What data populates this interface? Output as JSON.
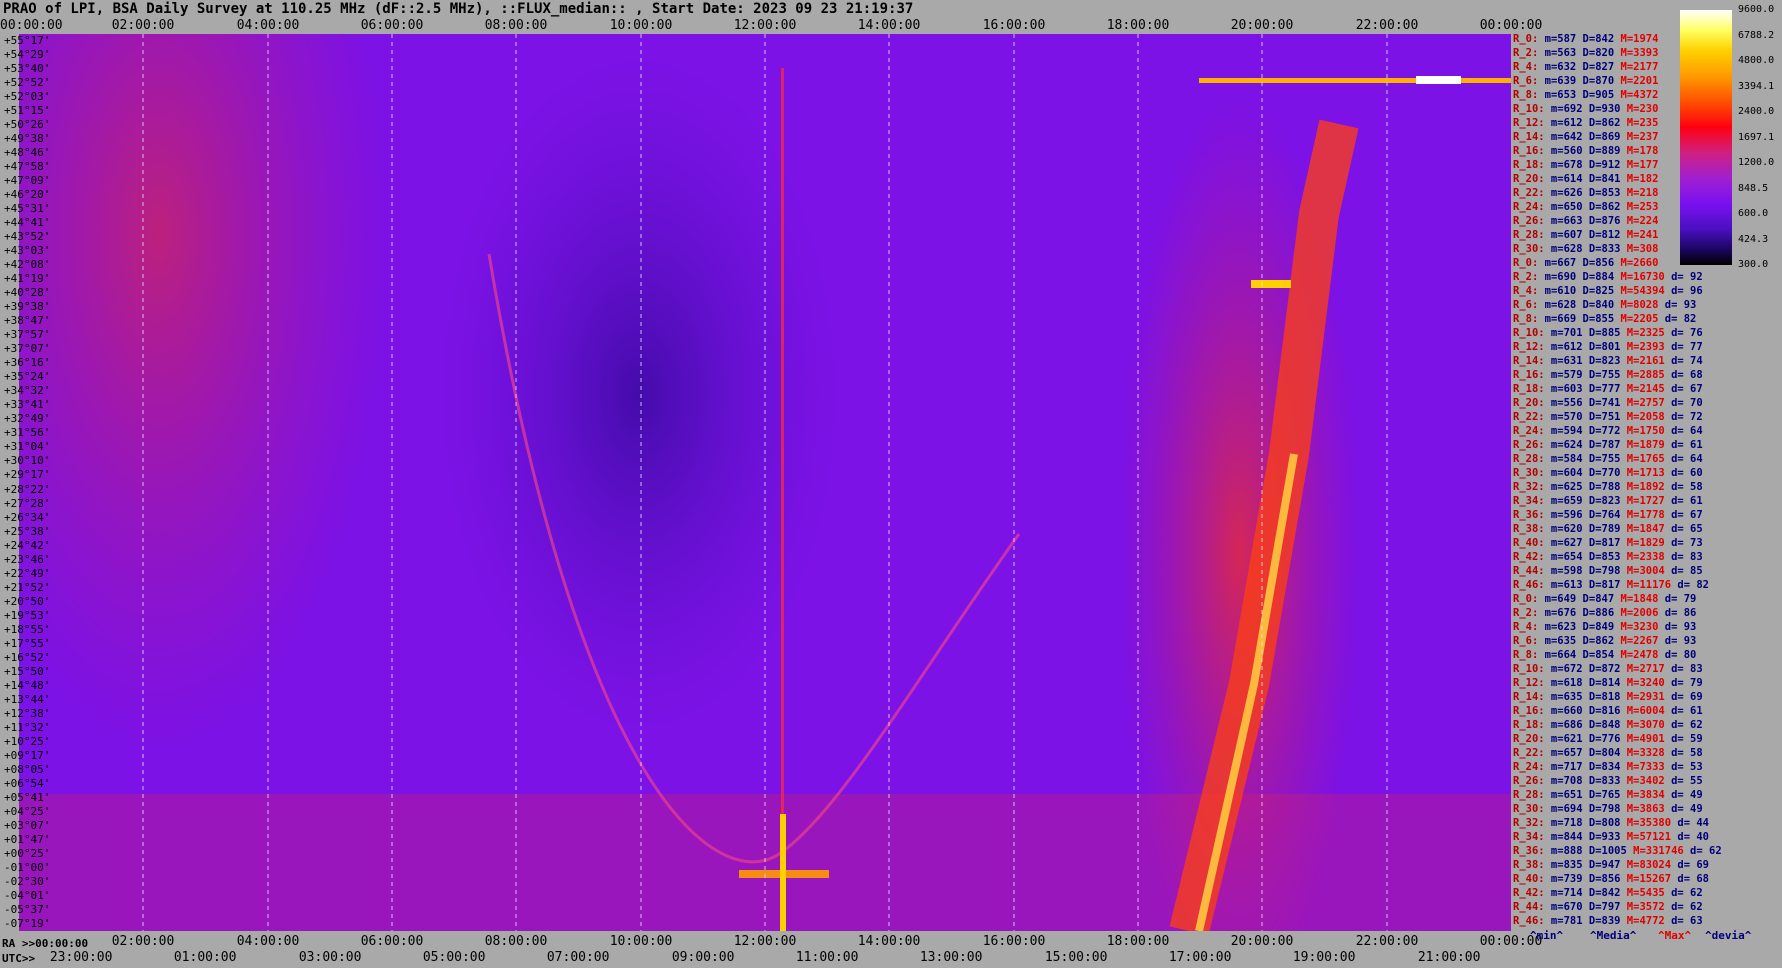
{
  "title": "PRAO of LPI, BSA Daily Survey at 110.25 MHz (dF::2.5 MHz), ::FLUX_median:: , Start Date: 2023 09 23 21:19:37",
  "chart_data": {
    "type": "heatmap",
    "title": "PRAO of LPI, BSA Daily Survey at 110.25 MHz (dF::2.5 MHz), ::FLUX_median:: , Start Date: 2023 09 23 21:19:37",
    "x_top_ticks": [
      "00:00:00",
      "02:00:00",
      "04:00:00",
      "06:00:00",
      "08:00:00",
      "10:00:00",
      "12:00:00",
      "14:00:00",
      "16:00:00",
      "18:00:00",
      "20:00:00",
      "22:00:00",
      "00:00:00"
    ],
    "x_ra_ticks": [
      "00:00:00",
      "02:00:00",
      "04:00:00",
      "06:00:00",
      "08:00:00",
      "10:00:00",
      "12:00:00",
      "14:00:00",
      "16:00:00",
      "18:00:00",
      "20:00:00",
      "22:00:00",
      "00:00:00"
    ],
    "x_utc_ticks": [
      "23:00:00",
      "01:00:00",
      "03:00:00",
      "05:00:00",
      "07:00:00",
      "09:00:00",
      "11:00:00",
      "13:00:00",
      "15:00:00",
      "17:00:00",
      "19:00:00",
      "21:00:00"
    ],
    "ra_label": "RA >>00:00:00",
    "utc_label": "UTC>>",
    "declinations": [
      "+55°17'",
      "+54°29'",
      "+53°40'",
      "+52°52'",
      "+52°03'",
      "+51°15'",
      "+50°26'",
      "+49°38'",
      "+48°46'",
      "+47°58'",
      "+47°09'",
      "+46°20'",
      "+45°31'",
      "+44°41'",
      "+43°52'",
      "+43°03'",
      "+42°08'",
      "+41°19'",
      "+40°28'",
      "+39°38'",
      "+38°47'",
      "+37°57'",
      "+37°07'",
      "+36°16'",
      "+35°24'",
      "+34°32'",
      "+33°41'",
      "+32°49'",
      "+31°56'",
      "+31°04'",
      "+30°10'",
      "+29°17'",
      "+28°22'",
      "+27°28'",
      "+26°34'",
      "+25°38'",
      "+24°42'",
      "+23°46'",
      "+22°49'",
      "+21°52'",
      "+20°50'",
      "+19°53'",
      "+18°55'",
      "+17°55'",
      "+16°52'",
      "+15°50'",
      "+14°48'",
      "+13°44'",
      "+12°38'",
      "+11°32'",
      "+10°25'",
      "+09°17'",
      "+08°05'",
      "+06°54'",
      "+05°41'",
      "+04°25'",
      "+03°07'",
      "+01°47'",
      "+00°25'",
      "-01°00'",
      "-02°30'",
      "-04°01'",
      "-05°37'",
      "-07°19'"
    ],
    "colorbar": {
      "ticks": [
        "9600.0",
        "6788.2",
        "4800.0",
        "3394.1",
        "2400.0",
        "1697.1",
        "1200.0",
        "848.5",
        "600.0",
        "424.3",
        "300.0"
      ],
      "min": 300.0,
      "max": 9600.0,
      "scale": "log"
    },
    "stats_rows": [
      [
        "R_0:",
        "587",
        "842",
        "1974",
        ""
      ],
      [
        "R_2:",
        "563",
        "820",
        "3393",
        ""
      ],
      [
        "R_4:",
        "632",
        "827",
        "2177",
        ""
      ],
      [
        "R_6:",
        "639",
        "870",
        "2201",
        ""
      ],
      [
        "R_8:",
        "653",
        "905",
        "4372",
        ""
      ],
      [
        "R_10:",
        "692",
        "930",
        "230",
        ""
      ],
      [
        "R_12:",
        "612",
        "862",
        "235",
        ""
      ],
      [
        "R_14:",
        "642",
        "869",
        "237",
        ""
      ],
      [
        "R_16:",
        "560",
        "889",
        "178",
        ""
      ],
      [
        "R_18:",
        "678",
        "912",
        "177",
        ""
      ],
      [
        "R_20:",
        "614",
        "841",
        "182",
        ""
      ],
      [
        "R_22:",
        "626",
        "853",
        "218",
        ""
      ],
      [
        "R_24:",
        "650",
        "862",
        "253",
        ""
      ],
      [
        "R_26:",
        "663",
        "876",
        "224",
        ""
      ],
      [
        "R_28:",
        "607",
        "812",
        "241",
        ""
      ],
      [
        "R_30:",
        "628",
        "833",
        "308",
        ""
      ],
      [
        "R_0:",
        "667",
        "856",
        "2660",
        ""
      ],
      [
        "R_2:",
        "690",
        "884",
        "16730",
        "92"
      ],
      [
        "R_4:",
        "610",
        "825",
        "54394",
        "96"
      ],
      [
        "R_6:",
        "628",
        "840",
        "8028",
        "93"
      ],
      [
        "R_8:",
        "669",
        "855",
        "2205",
        "82"
      ],
      [
        "R_10:",
        "701",
        "885",
        "2325",
        "76"
      ],
      [
        "R_12:",
        "612",
        "801",
        "2393",
        "77"
      ],
      [
        "R_14:",
        "631",
        "823",
        "2161",
        "74"
      ],
      [
        "R_16:",
        "579",
        "755",
        "2885",
        "68"
      ],
      [
        "R_18:",
        "603",
        "777",
        "2145",
        "67"
      ],
      [
        "R_20:",
        "556",
        "741",
        "2757",
        "70"
      ],
      [
        "R_22:",
        "570",
        "751",
        "2058",
        "72"
      ],
      [
        "R_24:",
        "594",
        "772",
        "1750",
        "64"
      ],
      [
        "R_26:",
        "624",
        "787",
        "1879",
        "61"
      ],
      [
        "R_28:",
        "584",
        "755",
        "1765",
        "64"
      ],
      [
        "R_30:",
        "604",
        "770",
        "1713",
        "60"
      ],
      [
        "R_32:",
        "625",
        "788",
        "1892",
        "58"
      ],
      [
        "R_34:",
        "659",
        "823",
        "1727",
        "61"
      ],
      [
        "R_36:",
        "596",
        "764",
        "1778",
        "67"
      ],
      [
        "R_38:",
        "620",
        "789",
        "1847",
        "65"
      ],
      [
        "R_40:",
        "627",
        "817",
        "1829",
        "73"
      ],
      [
        "R_42:",
        "654",
        "853",
        "2338",
        "83"
      ],
      [
        "R_44:",
        "598",
        "798",
        "3004",
        "85"
      ],
      [
        "R_46:",
        "613",
        "817",
        "11176",
        "82"
      ],
      [
        "R_0:",
        "649",
        "847",
        "1848",
        "79"
      ],
      [
        "R_2:",
        "676",
        "886",
        "2006",
        "86"
      ],
      [
        "R_4:",
        "623",
        "849",
        "3230",
        "93"
      ],
      [
        "R_6:",
        "635",
        "862",
        "2267",
        "93"
      ],
      [
        "R_8:",
        "664",
        "854",
        "2478",
        "80"
      ],
      [
        "R_10:",
        "672",
        "872",
        "2717",
        "83"
      ],
      [
        "R_12:",
        "618",
        "814",
        "3240",
        "79"
      ],
      [
        "R_14:",
        "635",
        "818",
        "2931",
        "69"
      ],
      [
        "R_16:",
        "660",
        "816",
        "6004",
        "61"
      ],
      [
        "R_18:",
        "686",
        "848",
        "3070",
        "62"
      ],
      [
        "R_20:",
        "621",
        "776",
        "4901",
        "59"
      ],
      [
        "R_22:",
        "657",
        "804",
        "3328",
        "58"
      ],
      [
        "R_24:",
        "717",
        "834",
        "7333",
        "53"
      ],
      [
        "R_26:",
        "708",
        "833",
        "3402",
        "55"
      ],
      [
        "R_28:",
        "651",
        "765",
        "3834",
        "49"
      ],
      [
        "R_30:",
        "694",
        "798",
        "3863",
        "49"
      ],
      [
        "R_32:",
        "718",
        "808",
        "35380",
        "44"
      ],
      [
        "R_34:",
        "844",
        "933",
        "57121",
        "40"
      ],
      [
        "R_36:",
        "888",
        "1005",
        "331746",
        "62"
      ],
      [
        "R_38:",
        "835",
        "947",
        "83024",
        "69"
      ],
      [
        "R_40:",
        "739",
        "856",
        "15267",
        "68"
      ],
      [
        "R_42:",
        "714",
        "842",
        "5435",
        "62"
      ],
      [
        "R_44:",
        "670",
        "797",
        "3572",
        "62"
      ],
      [
        "R_46:",
        "781",
        "839",
        "4772",
        "63"
      ]
    ],
    "stats_legend": {
      "min": "^min^",
      "median": "^Media^",
      "max": "^Max^",
      "dev": "^devia^"
    }
  }
}
